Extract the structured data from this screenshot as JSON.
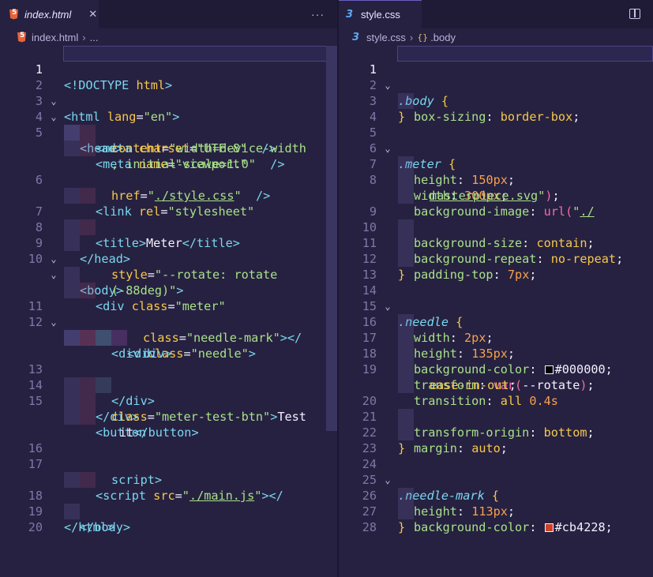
{
  "left": {
    "tab": "index.html",
    "more_label": "···",
    "breadcrumb": [
      "index.html",
      "..."
    ],
    "lines": [
      [
        "1",
        "<!DOCTYPE html>"
      ],
      [
        "2",
        "<html lang=\"en\">"
      ],
      [
        "3",
        "<head>"
      ],
      [
        "4",
        "<meta charset=\"UTF-8\" />"
      ],
      [
        "5",
        "<meta name=\"viewport\"",
        "content=\"width=device-width",
        ", initial-scale=1.0\" />"
      ],
      [
        "6",
        "<link rel=\"stylesheet\"",
        "href=\"./style.css\" />"
      ],
      [
        "7",
        "<title>Meter</title>"
      ],
      [
        "8",
        "</head>"
      ],
      [
        "9",
        "<body>"
      ],
      [
        "10",
        "<div class=\"meter\"",
        "style=\"--rotate: rotate",
        "(-88deg)\">"
      ],
      [
        "11",
        "<div class=\"needle\">"
      ],
      [
        "12",
        "<div",
        "class=\"needle-mark\"></",
        "div>"
      ],
      [
        "13",
        "</div>"
      ],
      [
        "14",
        "</div>"
      ],
      [
        "15",
        "<button",
        "class=\"meter-test-btn\">Test",
        "it</button>"
      ],
      [
        "16",
        ""
      ],
      [
        "17",
        "<script src=\"./main.js\"></",
        "script>"
      ],
      [
        "18",
        "</body>"
      ],
      [
        "19",
        "</html>"
      ],
      [
        "20",
        ""
      ]
    ]
  },
  "right": {
    "tab": "style.css",
    "breadcrumb": [
      "style.css",
      ".body"
    ],
    "swatch_black": "#000000",
    "swatch_red": "#cb4228",
    "lines": [
      [
        "1",
        ".body {"
      ],
      [
        "2",
        "box-sizing: border-box;"
      ],
      [
        "3",
        "}"
      ],
      [
        "4",
        ""
      ],
      [
        "5",
        ".meter {"
      ],
      [
        "6",
        "height: 150px;"
      ],
      [
        "7",
        "width: 300px;"
      ],
      [
        "8",
        "background-image: url(\"./",
        "masterpiece.svg\");"
      ],
      [
        "9",
        "background-size: contain;"
      ],
      [
        "10",
        "background-repeat: no-repeat;"
      ],
      [
        "11",
        "padding-top: 7px;"
      ],
      [
        "12",
        "}"
      ],
      [
        "13",
        ""
      ],
      [
        "14",
        ".needle {"
      ],
      [
        "15",
        "width: 2px;"
      ],
      [
        "16",
        "height: 135px;"
      ],
      [
        "17",
        "background-color: #000000;"
      ],
      [
        "18",
        "transform: var(--rotate);"
      ],
      [
        "19",
        "transition: all 0.4s",
        "ease-in-out;"
      ],
      [
        "20",
        "transform-origin: bottom;"
      ],
      [
        "21",
        "margin: auto;"
      ],
      [
        "22",
        "}"
      ],
      [
        "23",
        ""
      ],
      [
        "24",
        ".needle-mark {"
      ],
      [
        "25",
        "height: 113px;"
      ],
      [
        "26",
        "background-color: #cb4228;"
      ],
      [
        "27",
        "}"
      ],
      [
        "28",
        ""
      ]
    ]
  }
}
